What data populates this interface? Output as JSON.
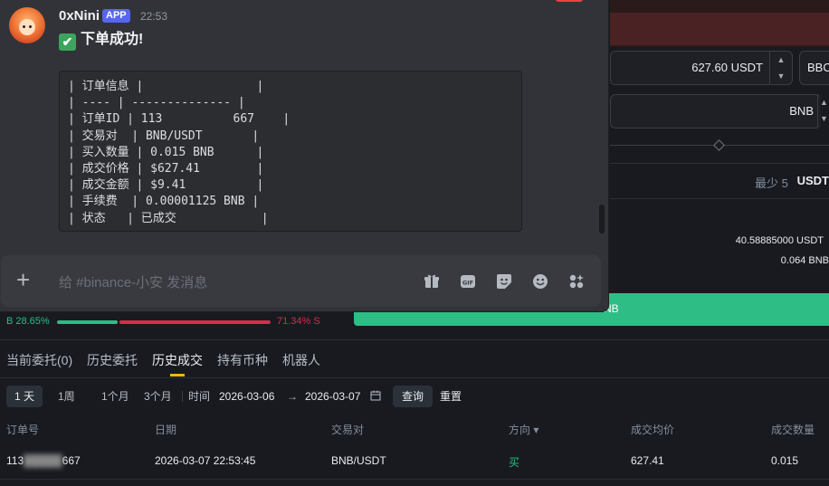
{
  "exchange": {
    "price_value": "627.60",
    "price_unit": "USDT",
    "bbo_label": "BBO",
    "amount_unit": "BNB",
    "total_placeholder": "最少 5",
    "total_unit": "USDT",
    "available": "40.58885000 USDT",
    "max_buy": "0.064 BNB",
    "buy_button_label": "NB",
    "ratio": {
      "buy_label": "B 28.65%",
      "sell_label": "71.34% S",
      "buy_fraction": 0.2865
    },
    "tabs": [
      "当前委托(0)",
      "历史委托",
      "历史成交",
      "持有币种",
      "机器人"
    ],
    "active_tab": "历史成交",
    "periods": [
      "1 天",
      "1周",
      "1个月",
      "3个月"
    ],
    "time_label": "时间",
    "date_from": "2026-03-06",
    "date_arrow": "→",
    "date_to": "2026-03-07",
    "query_button": "查询",
    "reset_button": "重置",
    "columns": [
      "订单号",
      "日期",
      "交易对",
      "方向 ▾",
      "成交均价",
      "成交数量"
    ],
    "rows": [
      {
        "order_id_start": "113",
        "order_id_end": "667",
        "date": "2026-03-07 22:53:45",
        "pair": "BNB/USDT",
        "side": "买",
        "avg_price": "627.41",
        "qty": "0.015"
      }
    ]
  },
  "discord": {
    "username": "0xNini",
    "badge": "APP",
    "timestamp": "22:53",
    "title_emoji": "✔",
    "title": "下单成功!",
    "code_lines": [
      "| 订单信息 |                |",
      "| ---- | -------------- |",
      "| 订单ID | 113          667    |",
      "| 交易对  | BNB/USDT       |",
      "| 买入数量 | 0.015 BNB      |",
      "| 成交价格 | $627.41        |",
      "| 成交金额 | $9.41          |",
      "| 手续费  | 0.00001125 BNB |",
      "| 状态   | 已成交            |"
    ],
    "composer_placeholder": "给 #binance-小安 发消息",
    "composer_icons": [
      "gift-icon",
      "gif-icon",
      "sticker-icon",
      "emoji-icon",
      "apps-icon"
    ]
  }
}
